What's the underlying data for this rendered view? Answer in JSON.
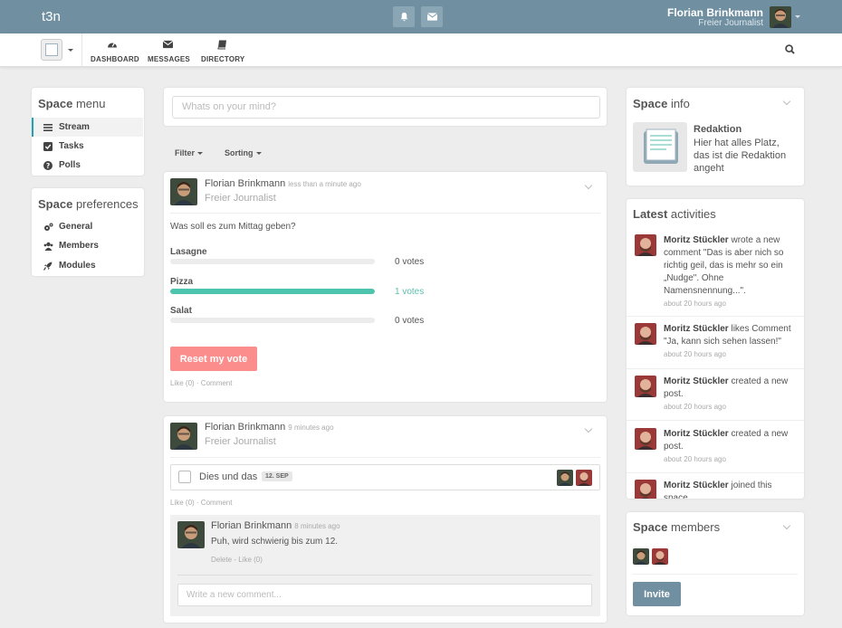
{
  "app": {
    "brand": "t3n"
  },
  "user": {
    "name": "Florian Brinkmann",
    "title": "Freier Journalist"
  },
  "nav": {
    "items": [
      {
        "label": "DASHBOARD",
        "icon": "dashboard-icon"
      },
      {
        "label": "MESSAGES",
        "icon": "envelope-icon"
      },
      {
        "label": "DIRECTORY",
        "icon": "book-icon"
      }
    ]
  },
  "space_menu": {
    "title_bold": "Space",
    "title_rest": "menu",
    "items": [
      {
        "label": "Stream",
        "icon": "list-icon",
        "active": true
      },
      {
        "label": "Tasks",
        "icon": "checkbox-icon"
      },
      {
        "label": "Polls",
        "icon": "question-icon"
      }
    ]
  },
  "space_prefs": {
    "title_bold": "Space",
    "title_rest": "preferences",
    "items": [
      {
        "label": "General",
        "icon": "cogs-icon"
      },
      {
        "label": "Members",
        "icon": "users-icon"
      },
      {
        "label": "Modules",
        "icon": "rocket-icon"
      }
    ]
  },
  "composer": {
    "placeholder": "Whats on your mind?"
  },
  "filters": {
    "filter": "Filter",
    "sorting": "Sorting"
  },
  "poll_post": {
    "author": "Florian Brinkmann",
    "time": "less than a minute ago",
    "subtitle": "Freier Journalist",
    "question": "Was soll es zum Mittag geben?",
    "options": [
      {
        "label": "Lasagne",
        "votes": "0 votes",
        "fraction": 0
      },
      {
        "label": "Pizza",
        "votes": "1 votes",
        "fraction": 1
      },
      {
        "label": "Salat",
        "votes": "0 votes",
        "fraction": 0
      }
    ],
    "reset_label": "Reset my vote",
    "like": "Like (0)",
    "comment": "Comment"
  },
  "task_post": {
    "author": "Florian Brinkmann",
    "time": "9 minutes ago",
    "subtitle": "Freier Journalist",
    "task_title": "Dies und das",
    "due": "12. SEP",
    "like": "Like (0)",
    "comment": "Comment",
    "comment_item": {
      "author": "Florian Brinkmann",
      "time": "8 minutes ago",
      "text": "Puh, wird schwierig bis zum 12.",
      "actions": "Delete - Like (0)"
    },
    "comment_placeholder": "Write a new comment..."
  },
  "space_info": {
    "title_bold": "Space",
    "title_rest": "info",
    "name": "Redaktion",
    "description": "Hier hat alles Platz, das ist die Redaktion angeht"
  },
  "latest": {
    "title_bold": "Latest",
    "title_rest": "activities",
    "items": [
      {
        "user": "Moritz Stückler",
        "text": " wrote a new comment \"Das is aber nich so richtig geil, das is mehr so ein „Nudge\". Ohne Namensnennung...\".",
        "time": "about 20 hours ago"
      },
      {
        "user": "Moritz Stückler",
        "text": " likes Comment \"Ja, kann sich sehen lassen!\"",
        "time": "about 20 hours ago"
      },
      {
        "user": "Moritz Stückler",
        "text": " created a new post.",
        "time": "about 20 hours ago"
      },
      {
        "user": "Moritz Stückler",
        "text": " created a new post.",
        "time": "about 20 hours ago"
      },
      {
        "user": "Moritz Stückler",
        "text": " joined this space.",
        "time": ""
      }
    ]
  },
  "members": {
    "title_bold": "Space",
    "title_rest": "members",
    "invite": "Invite"
  },
  "colors": {
    "topbar": "#708fa0",
    "accent": "#21a1b3",
    "poll_fill": "#4dc4ad",
    "reset_button": "#fc8d8d",
    "invite_button": "#708fa0"
  }
}
